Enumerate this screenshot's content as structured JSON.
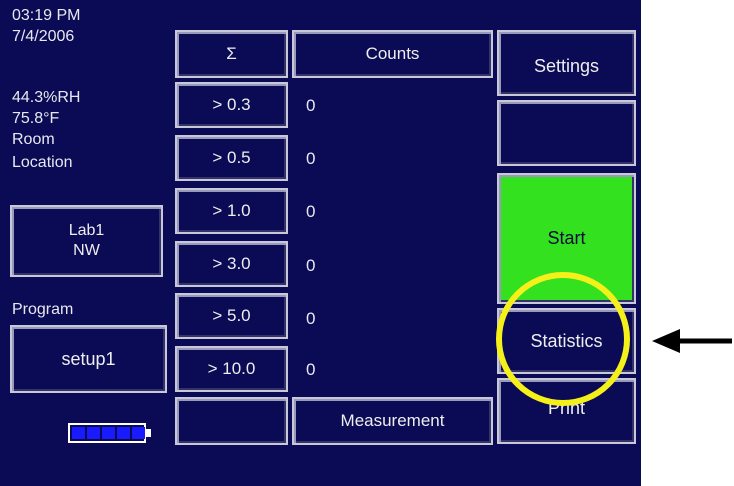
{
  "status": {
    "time": "03:19 PM",
    "date": "7/4/2006",
    "humidity": "44.3%RH",
    "temperature": "75.8°F",
    "room_label": "Room",
    "location_label": "Location",
    "location_line1": "Lab1",
    "location_line2": "NW",
    "program_label": "Program",
    "program_value": "setup1",
    "battery_level": 1.0
  },
  "table": {
    "sigma_header": "Σ",
    "counts_header": "Counts",
    "rows": [
      {
        "size": "> 0.3",
        "count": "0"
      },
      {
        "size": "> 0.5",
        "count": "0"
      },
      {
        "size": "> 1.0",
        "count": "0"
      },
      {
        "size": "> 3.0",
        "count": "0"
      },
      {
        "size": "> 5.0",
        "count": "0"
      },
      {
        "size": "> 10.0",
        "count": "0"
      }
    ],
    "empty_footer": "",
    "measurement_label": "Measurement"
  },
  "right_panel": {
    "settings_label": "Settings",
    "blank_label": "",
    "start_label": "Start",
    "statistics_label": "Statistics",
    "print_label": "Print"
  },
  "colors": {
    "screen_bg": "#0a0a55",
    "start_green": "#33e11f",
    "highlight_yellow": "#f5f01a",
    "battery_blue": "#1a1aff"
  }
}
